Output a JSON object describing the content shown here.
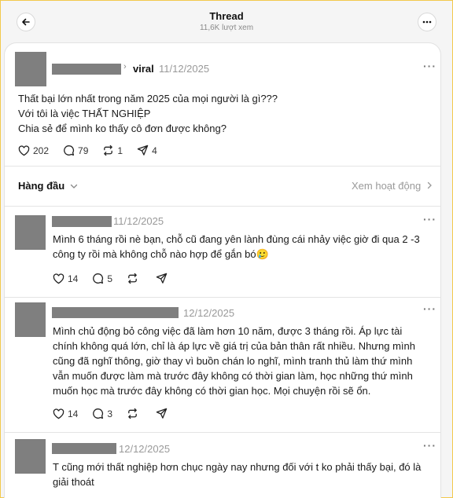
{
  "header": {
    "title": "Thread",
    "views": "11,6K lượt xem"
  },
  "post": {
    "author": "viral",
    "date": "11/12/2025",
    "lines": [
      "Thất bại lớn nhất trong năm 2025 của mọi người là gì???",
      "Với tôi là việc THẤT NGHIỆP",
      "Chia sẻ để mình ko thấy cô đơn được không?"
    ],
    "likes": "202",
    "replies": "79",
    "reposts": "1",
    "shares": "4"
  },
  "sort": {
    "label": "Hàng đầu",
    "activity": "Xem hoạt động"
  },
  "comments": [
    {
      "date": "11/12/2025",
      "lines": [
        "Mình 6 tháng rồi nè bạn, chỗ cũ đang yên lành đùng cái nhảy việc giờ đi qua 2 -3",
        "công ty rồi mà không chỗ nào hợp để gắn bó🥲"
      ],
      "likes": "14",
      "replies": "5"
    },
    {
      "date": "12/12/2025",
      "lines": [
        "Mình chủ động bỏ công việc đã làm hơn 10 năm, được 3 tháng rồi. Áp lực tài",
        "chính không quá lớn, chỉ là áp lực về giá trị của bản thân rất nhiều. Nhưng mình",
        "cũng đã nghĩ thông, giờ thay vì buồn chán lo nghĩ, mình tranh thủ làm thứ mình",
        "vẫn muốn được làm mà trước đây không có thời gian làm, học những thứ mình",
        "muốn học mà trước đây không có thời gian học. Mọi chuyện rồi sẽ ổn."
      ],
      "likes": "14",
      "replies": "3"
    },
    {
      "date": "12/12/2025",
      "lines": [
        "T cũng mới thất nghiệp hơn chục ngày nay nhưng đối với t ko phải thấy bại, đó là",
        "giải thoát"
      ]
    }
  ]
}
